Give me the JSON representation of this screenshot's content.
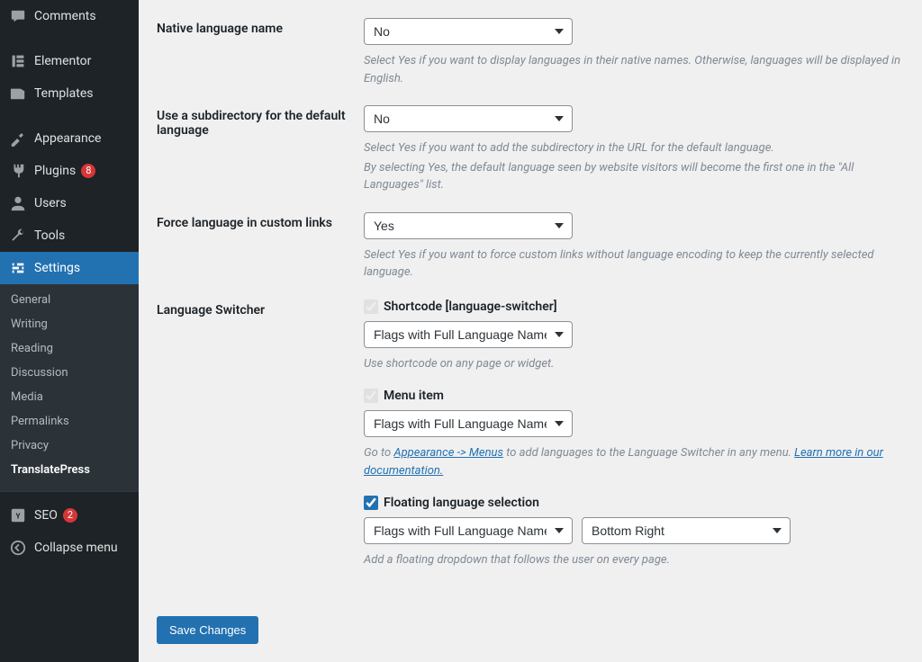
{
  "sidebar": {
    "items": [
      {
        "label": "Comments",
        "icon": "comment-icon"
      },
      {
        "label": "Elementor",
        "icon": "elementor-icon"
      },
      {
        "label": "Templates",
        "icon": "templates-icon"
      },
      {
        "label": "Appearance",
        "icon": "appearance-icon"
      },
      {
        "label": "Plugins",
        "icon": "plugins-icon",
        "badge": "8"
      },
      {
        "label": "Users",
        "icon": "users-icon"
      },
      {
        "label": "Tools",
        "icon": "tools-icon"
      },
      {
        "label": "Settings",
        "icon": "settings-icon",
        "current": true
      },
      {
        "label": "SEO",
        "icon": "seo-icon",
        "badge": "2"
      },
      {
        "label": "Collapse menu",
        "icon": "collapse-icon"
      }
    ],
    "submenu": [
      "General",
      "Writing",
      "Reading",
      "Discussion",
      "Media",
      "Permalinks",
      "Privacy",
      "TranslatePress"
    ],
    "submenu_active": "TranslatePress"
  },
  "settings": {
    "native_lang": {
      "label": "Native language name",
      "value": "No",
      "desc": "Select Yes if you want to display languages in their native names. Otherwise, languages will be displayed in English."
    },
    "subdir": {
      "label": "Use a subdirectory for the default language",
      "value": "No",
      "desc1": "Select Yes if you want to add the subdirectory in the URL for the default language.",
      "desc2": "By selecting Yes, the default language seen by website visitors will become the first one in the \"All Languages\" list."
    },
    "force_links": {
      "label": "Force language in custom links",
      "value": "Yes",
      "desc": "Select Yes if you want to force custom links without language encoding to keep the currently selected language."
    },
    "switcher": {
      "label": "Language Switcher",
      "shortcode": {
        "chk_label": "Shortcode [language-switcher]",
        "value": "Flags with Full Language Names",
        "desc": "Use shortcode on any page or widget."
      },
      "menu": {
        "chk_label": "Menu item",
        "value": "Flags with Full Language Names",
        "desc_pre": "Go to ",
        "link1": "Appearance -> Menus",
        "desc_mid": " to add languages to the Language Switcher in any menu. ",
        "link2": "Learn more in our documentation."
      },
      "floating": {
        "chk_label": "Floating language selection",
        "value": "Flags with Full Language Names",
        "position": "Bottom Right",
        "desc": "Add a floating dropdown that follows the user on every page."
      }
    },
    "save": "Save Changes"
  }
}
